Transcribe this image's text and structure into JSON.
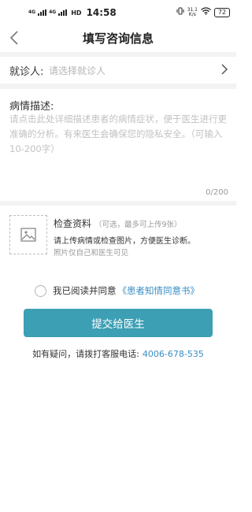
{
  "status_bar": {
    "signal1": "4G",
    "signal2": "4G",
    "hd": "HD",
    "time": "14:58",
    "net_speed_value": "31.1",
    "net_speed_unit": "K/s",
    "battery": "72"
  },
  "header": {
    "title": "填写咨询信息"
  },
  "patient": {
    "label": "就诊人:",
    "placeholder": "请选择就诊人"
  },
  "description": {
    "label": "病情描述:",
    "placeholder": "请点击此处详细描述患者的病情症状，便于医生进行更准确的分析。有来医生会确保您的隐私安全。（可输入10-200字）",
    "value": "",
    "counter": "0/200"
  },
  "upload": {
    "title": "检查资料",
    "note": "（可选，最多可上传9张）",
    "desc": "请上传病情或检查图片，方便医生诊断。",
    "sub_desc": "照片仅自己和医生可见"
  },
  "agreement": {
    "text": "我已阅读并同意",
    "link": "《患者知情同意书》",
    "checked": false
  },
  "submit": {
    "label": "提交给医生"
  },
  "help": {
    "text": "如有疑问，请拨打客服电话:",
    "phone": "4006-678-535"
  },
  "colors": {
    "accent": "#3d9fb4",
    "link": "#3a8ec4",
    "divider": "#f3f3f3"
  }
}
